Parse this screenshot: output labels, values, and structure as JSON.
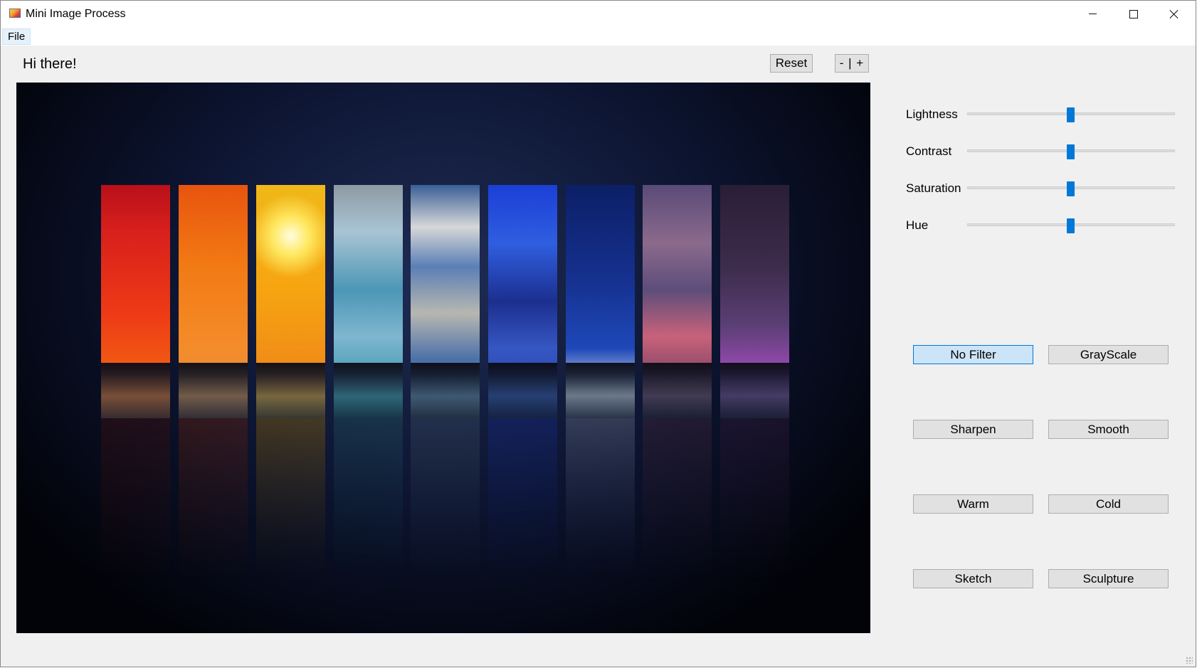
{
  "window": {
    "title": "Mini Image Process",
    "icon": "app-image-icon",
    "controls": [
      "minimize-icon",
      "maximize-icon",
      "close-icon"
    ]
  },
  "menu": {
    "file": "File"
  },
  "header": {
    "greeting": "Hi there!",
    "reset_label": "Reset",
    "zoom_label": "- | +"
  },
  "image": {
    "description_colors": [
      "#e8301e",
      "#f26b1c",
      "#f7b418",
      "#5aa7c2",
      "#7a9fc9",
      "#2a4ad0",
      "#1b2f8a",
      "#7f4c7e",
      "#4b2656"
    ]
  },
  "sliders": [
    {
      "label": "Lightness",
      "value": 50
    },
    {
      "label": "Contrast",
      "value": 50
    },
    {
      "label": "Saturation",
      "value": 50
    },
    {
      "label": "Hue",
      "value": 50
    }
  ],
  "filters": {
    "no_filter": "No Filter",
    "grayscale": "GrayScale",
    "sharpen": "Sharpen",
    "smooth": "Smooth",
    "warm": "Warm",
    "cold": "Cold",
    "sketch": "Sketch",
    "sculpture": "Sculpture",
    "active": "No Filter"
  },
  "colors": {
    "accent": "#0078d7",
    "window_bg": "#f0f0f0",
    "button_bg": "#e1e1e1",
    "active_button_bg": "#cce4f7"
  }
}
